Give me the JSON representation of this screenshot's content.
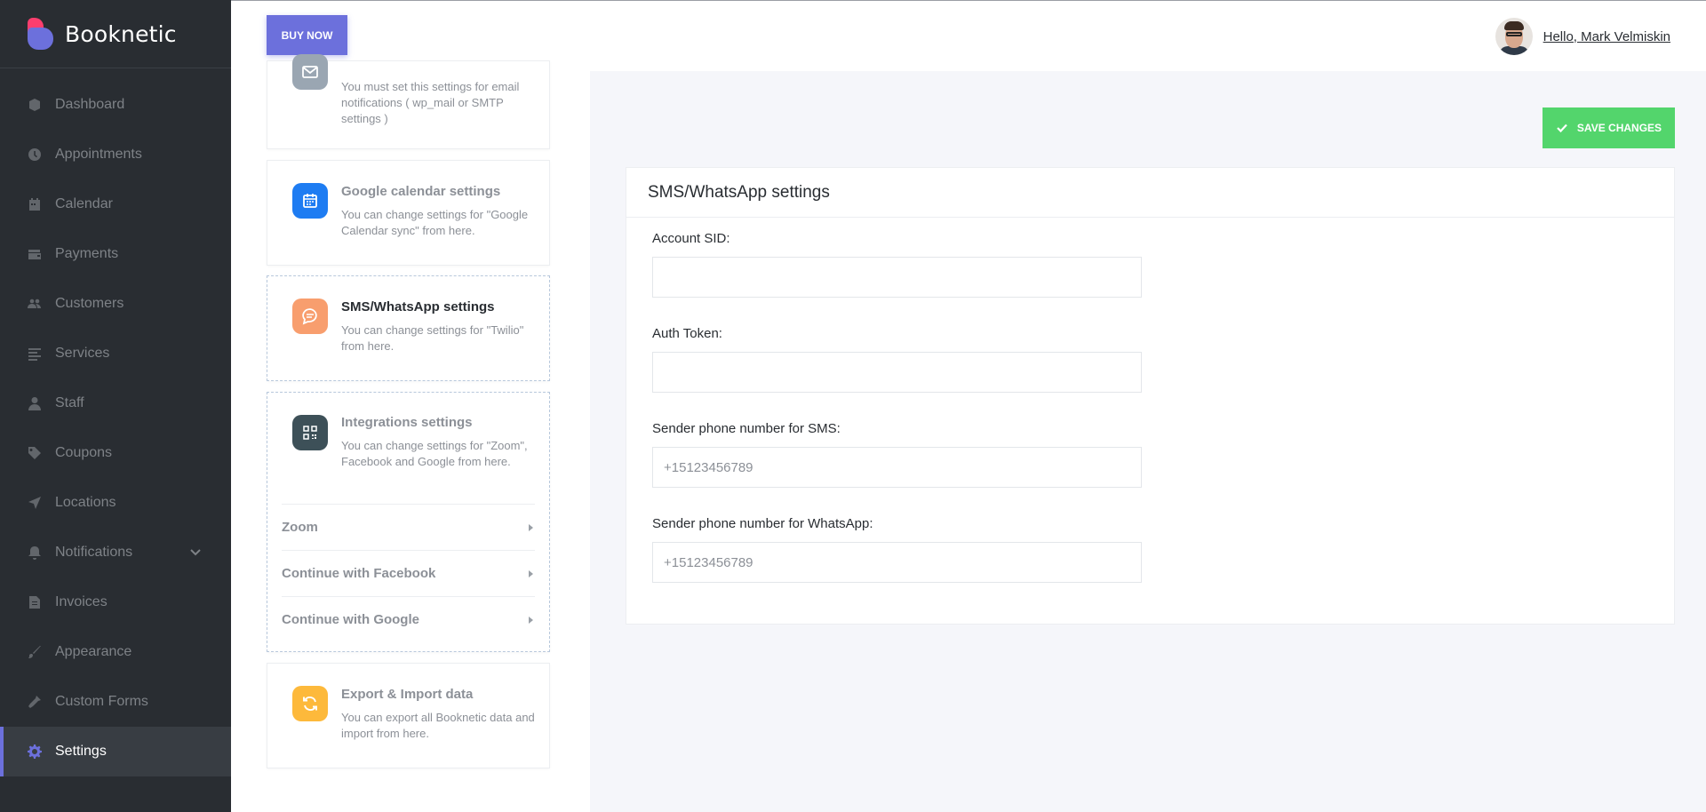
{
  "brand": {
    "name": "Booknetic"
  },
  "sidebar": {
    "items": [
      {
        "label": "Dashboard",
        "icon": "dashboard-icon"
      },
      {
        "label": "Appointments",
        "icon": "clock-icon"
      },
      {
        "label": "Calendar",
        "icon": "calendar-icon"
      },
      {
        "label": "Payments",
        "icon": "wallet-icon"
      },
      {
        "label": "Customers",
        "icon": "users-icon"
      },
      {
        "label": "Services",
        "icon": "list-icon"
      },
      {
        "label": "Staff",
        "icon": "user-icon"
      },
      {
        "label": "Coupons",
        "icon": "tag-icon"
      },
      {
        "label": "Locations",
        "icon": "location-arrow-icon"
      },
      {
        "label": "Notifications",
        "icon": "bell-icon"
      },
      {
        "label": "Invoices",
        "icon": "file-icon"
      },
      {
        "label": "Appearance",
        "icon": "brush-icon"
      },
      {
        "label": "Custom Forms",
        "icon": "tools-icon"
      },
      {
        "label": "Settings",
        "icon": "gear-icon"
      }
    ],
    "active": "Settings"
  },
  "topbar": {
    "buy_label": "BUY NOW",
    "greeting": "Hello, Mark Velmiskin"
  },
  "settings_cards": {
    "email": {
      "desc": "You must set this settings for email notifications ( wp_mail or SMTP settings )"
    },
    "google_calendar": {
      "title": "Google calendar settings",
      "desc": "You can change settings for \"Google Calendar sync\" from here."
    },
    "sms": {
      "title": "SMS/WhatsApp settings",
      "desc": "You can change settings for \"Twilio\" from here."
    },
    "integrations": {
      "title": "Integrations settings",
      "desc": "You can change settings for \"Zoom\", Facebook and Google from here.",
      "sub_items": [
        "Zoom",
        "Continue with Facebook",
        "Continue with Google"
      ]
    },
    "export": {
      "title": "Export & Import data",
      "desc": "You can export all Booknetic data and import from here."
    }
  },
  "main": {
    "save_label": "SAVE CHANGES",
    "panel_title": "SMS/WhatsApp settings",
    "fields": [
      {
        "label": "Account SID:",
        "value": "",
        "placeholder": ""
      },
      {
        "label": "Auth Token:",
        "value": "",
        "placeholder": ""
      },
      {
        "label": "Sender phone number for SMS:",
        "value": "",
        "placeholder": "+15123456789"
      },
      {
        "label": "Sender phone number for WhatsApp:",
        "value": "",
        "placeholder": "+15123456789"
      }
    ]
  },
  "colors": {
    "sidebar_bg": "#292d32",
    "accent": "#6c70dc",
    "save_green": "#53d56c",
    "google_blue": "#1e7cf2",
    "sms_orange": "#f89e6e",
    "integrations_dark": "#3d5058",
    "export_yellow": "#fdb93b"
  }
}
